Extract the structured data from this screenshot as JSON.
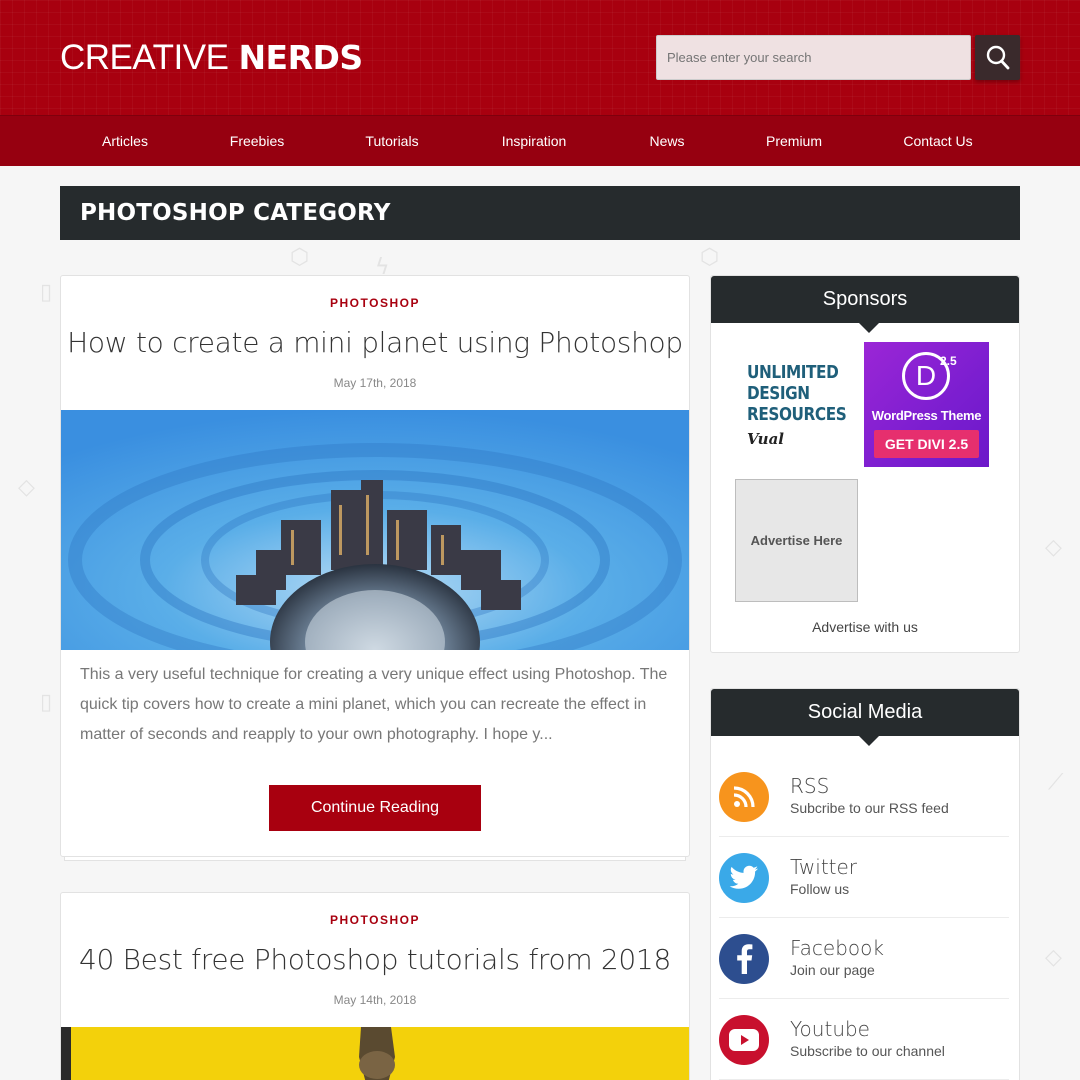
{
  "site": {
    "logo_light": "CREATIVE",
    "logo_bold": "NERDS"
  },
  "search": {
    "placeholder": "Please enter your search"
  },
  "nav": {
    "items": [
      "Articles",
      "Freebies",
      "Tutorials",
      "Inspiration",
      "News",
      "Premium",
      "Contact Us"
    ]
  },
  "category": {
    "title": "PHOTOSHOP CATEGORY"
  },
  "posts": [
    {
      "category": "PHOTOSHOP",
      "title": "How to create a mini planet using Photoshop",
      "date": "May 17th, 2018",
      "excerpt": "This a very useful technique for creating a very unique effect using Photoshop. The quick tip covers how to create a mini planet, which you can recreate the effect in matter of seconds and reapply to your own photography. I hope y...",
      "button": "Continue Reading"
    },
    {
      "category": "PHOTOSHOP",
      "title": "40 Best free Photoshop tutorials from 2018",
      "date": "May 14th, 2018"
    }
  ],
  "sponsors": {
    "title": "Sponsors",
    "ad1_lines": [
      "UNLIMITED",
      "DESIGN",
      "RESOURCES"
    ],
    "ad1_brand": "Vual",
    "ad2_letter": "D",
    "ad2_version": "2.5",
    "ad2_product": "WordPress Theme",
    "ad2_cta": "GET DIVI 2.5",
    "ad_slot": "Advertise Here",
    "advertise_link": "Advertise with us"
  },
  "social": {
    "title": "Social Media",
    "items": [
      {
        "name": "RSS",
        "sub": "Subcribe to our RSS feed",
        "icon": "rss-icon",
        "color": "#f7941d"
      },
      {
        "name": "Twitter",
        "sub": "Follow us",
        "icon": "twitter-icon",
        "color": "#3aa9e8"
      },
      {
        "name": "Facebook",
        "sub": "Join our page",
        "icon": "facebook-icon",
        "color": "#2d4e8f"
      },
      {
        "name": "Youtube",
        "sub": "Subscribe to our channel",
        "icon": "youtube-icon",
        "color": "#c8102e"
      }
    ]
  },
  "colors": {
    "brand_red": "#a8000f",
    "dark_bar": "#262b2d"
  }
}
